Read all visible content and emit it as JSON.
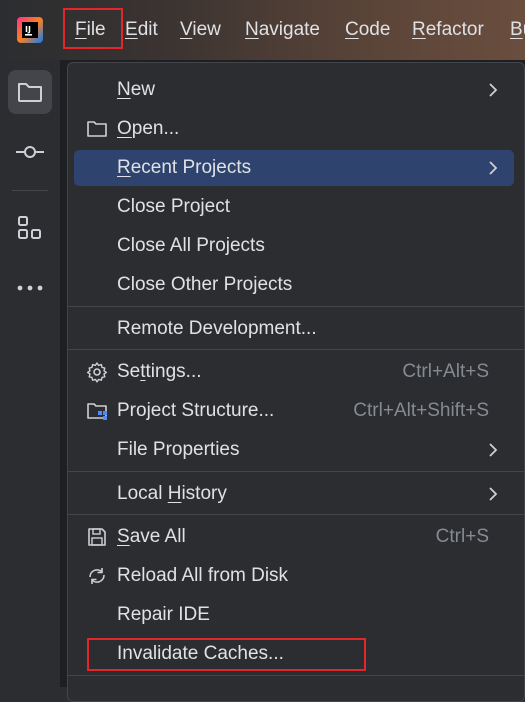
{
  "menubar": {
    "items": [
      {
        "label": "File",
        "mnemonic": "F",
        "rest": "ile"
      },
      {
        "label": "Edit",
        "mnemonic": "E",
        "rest": "dit"
      },
      {
        "label": "View",
        "mnemonic": "V",
        "rest": "iew"
      },
      {
        "label": "Navigate",
        "mnemonic": "N",
        "rest": "avigate"
      },
      {
        "label": "Code",
        "mnemonic": "C",
        "rest": "ode"
      },
      {
        "label": "Refactor",
        "mnemonic": "R",
        "rest": "efactor"
      },
      {
        "label": "Bu",
        "mnemonic": "B",
        "rest": "u"
      }
    ]
  },
  "toolstrip": {
    "icons": [
      "project-folder-icon",
      "commit-icon",
      "structure-icon",
      "more-icon"
    ]
  },
  "file_menu": {
    "new": {
      "pre": "",
      "u": "N",
      "post": "ew"
    },
    "open": {
      "pre": "",
      "u": "O",
      "post": "pen..."
    },
    "recent_projects": {
      "pre": "",
      "u": "R",
      "post": "ecent Projects"
    },
    "close_project": {
      "pre": "Close Pro",
      "u": "j",
      "post": "ect"
    },
    "close_all_projects": {
      "pre": "Close All Projects",
      "u": "",
      "post": ""
    },
    "close_other_projects": {
      "pre": "Close Other Projects",
      "u": "",
      "post": ""
    },
    "remote_development": {
      "pre": "Remote Development...",
      "u": "",
      "post": ""
    },
    "settings": {
      "pre": "Se",
      "u": "t",
      "post": "tings...",
      "shortcut": "Ctrl+Alt+S"
    },
    "project_structure": {
      "pre": "Project Structure...",
      "u": "",
      "post": "",
      "shortcut": "Ctrl+Alt+Shift+S"
    },
    "file_properties": {
      "pre": "File Properties",
      "u": "",
      "post": ""
    },
    "local_history": {
      "pre": "Local ",
      "u": "H",
      "post": "istory"
    },
    "save_all": {
      "pre": "",
      "u": "S",
      "post": "ave All",
      "shortcut": "Ctrl+S"
    },
    "reload_all": {
      "pre": "Reload All from Disk",
      "u": "",
      "post": ""
    },
    "repair_ide": {
      "pre": "Repair IDE",
      "u": "",
      "post": ""
    },
    "invalidate_caches": {
      "pre": "Invalidate Caches...",
      "u": "",
      "post": ""
    }
  },
  "colors": {
    "selection": "#2e436e",
    "highlight_box": "#e3252c",
    "menu_bg": "#2b2d30"
  }
}
